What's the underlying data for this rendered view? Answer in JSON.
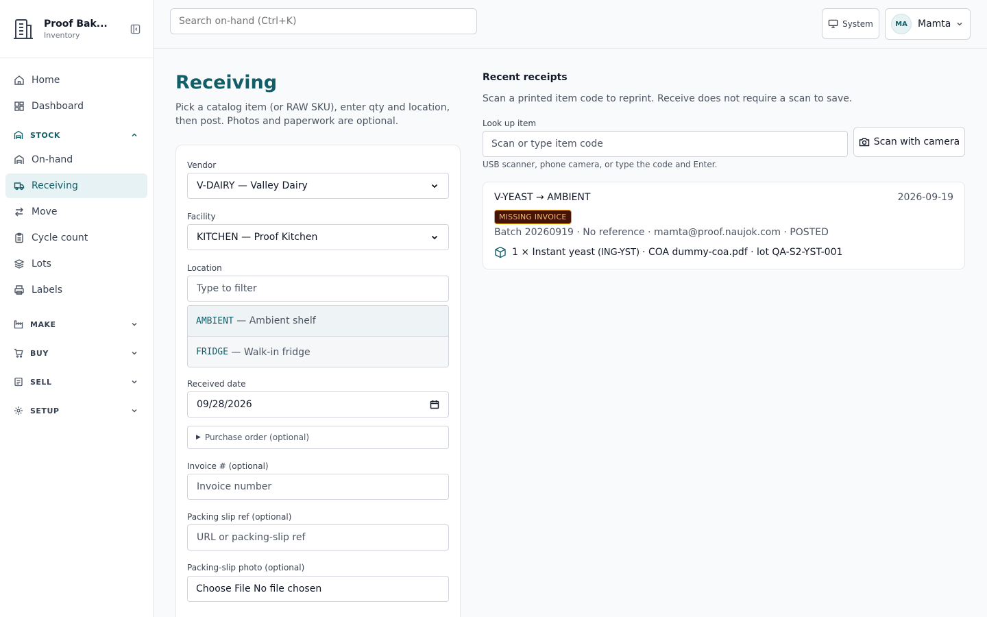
{
  "brand": {
    "name": "Proof Bak...",
    "subtitle": "Inventory"
  },
  "nav": {
    "home": "Home",
    "dashboard": "Dashboard",
    "stock": {
      "label": "STOCK",
      "items": [
        "On-hand",
        "Receiving",
        "Move",
        "Cycle count",
        "Lots",
        "Labels"
      ],
      "active": "Receiving"
    },
    "make": "MAKE",
    "buy": "BUY",
    "sell": "SELL",
    "setup": "SETUP"
  },
  "topbar": {
    "search_placeholder": "Search on-hand (Ctrl+K)",
    "theme_label": "System",
    "user_initials": "MA",
    "user_name": "Mamta"
  },
  "page": {
    "title": "Receiving",
    "description": "Pick a catalog item (or RAW SKU), enter qty and location, then post. Photos and paperwork are optional."
  },
  "form": {
    "vendor_label": "Vendor",
    "vendor_value": "V-DAIRY — Valley Dairy",
    "facility_label": "Facility",
    "facility_value": "KITCHEN — Proof Kitchen",
    "location_label": "Location",
    "location_placeholder": "Type to filter",
    "location_options": [
      {
        "code": "AMBIENT",
        "name": "— Ambient shelf"
      },
      {
        "code": "FRIDGE",
        "name": "— Walk-in fridge"
      }
    ],
    "received_date_label": "Received date",
    "received_date_value": "09/28/2026",
    "po_label": "Purchase order (optional)",
    "invoice_label": "Invoice # (optional)",
    "invoice_placeholder": "Invoice number",
    "packing_ref_label": "Packing slip ref (optional)",
    "packing_ref_placeholder": "URL or packing-slip ref",
    "packing_photo_label": "Packing-slip photo (optional)",
    "packing_photo_value": "Choose File No file chosen"
  },
  "recent": {
    "title": "Recent receipts",
    "description": "Scan a printed item code to reprint. Receive does not require a scan to save.",
    "lookup_label": "Look up item",
    "lookup_placeholder": "Scan or type item code",
    "scan_button": "Scan with camera",
    "lookup_hint": "USB scanner, phone camera, or type the code and Enter.",
    "receipt": {
      "route": "V-YEAST → AMBIENT",
      "date": "2026-09-19",
      "badge": "MISSING INVOICE",
      "meta": "Batch 20260919 · No reference · mamta@proof.naujok.com · POSTED",
      "line_qty": "1 × Instant yeast",
      "line_sku": "(ING-YST)",
      "line_rest": "· COA dummy-coa.pdf · lot QA-S2-YST-001"
    }
  },
  "colors": {
    "accent": "#115e67",
    "badge_bg": "#431407",
    "badge_fg": "#fdba74"
  }
}
